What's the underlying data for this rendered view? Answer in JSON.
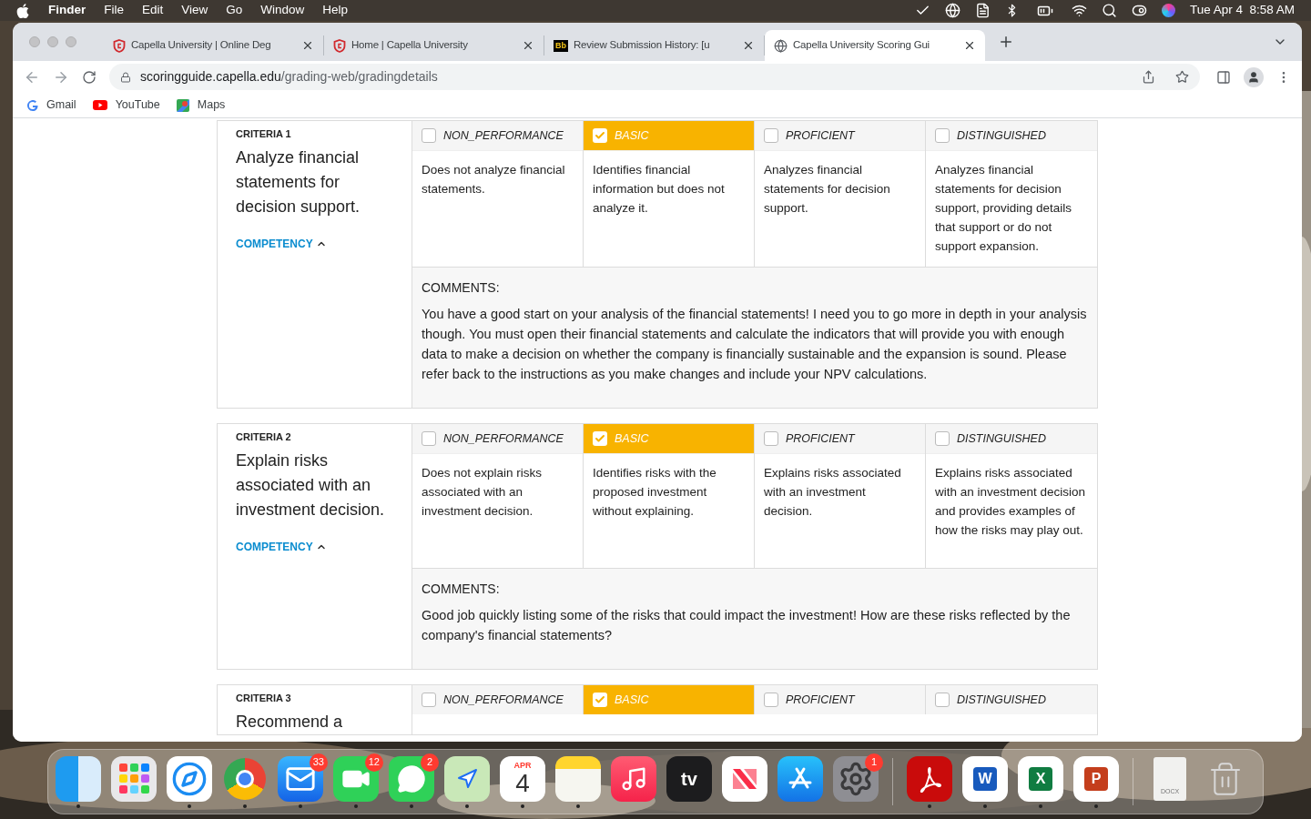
{
  "menu_bar": {
    "app": "Finder",
    "menus": [
      "File",
      "Edit",
      "View",
      "Go",
      "Window",
      "Help"
    ],
    "clock": "Tue Apr 4  8:58 AM"
  },
  "browser": {
    "tabs": [
      {
        "title": "Capella University | Online Deg",
        "selected": false,
        "kind": "shield"
      },
      {
        "title": "Home | Capella University",
        "selected": false,
        "kind": "shield"
      },
      {
        "title": "Review Submission History: [u",
        "selected": false,
        "kind": "bb",
        "icon_label": "Bb"
      },
      {
        "title": "Capella University Scoring Gui",
        "selected": true,
        "kind": "globe"
      }
    ],
    "address_host": "scoringguide.capella.edu",
    "address_path": "/grading-web/gradingdetails",
    "bookmarks": [
      {
        "label": "Gmail",
        "kind": "gmail"
      },
      {
        "label": "YouTube",
        "kind": "youtube"
      },
      {
        "label": "Maps",
        "kind": "maps"
      }
    ]
  },
  "criteria": [
    {
      "label": "CRITERIA 1",
      "title": "Analyze financial statements for decision support.",
      "competency": "COMPETENCY",
      "levels": [
        {
          "label": "NON_PERFORMANCE",
          "selected": false,
          "description": "Does not analyze financial statements."
        },
        {
          "label": "BASIC",
          "selected": true,
          "description": "Identifies financial information but does not analyze it."
        },
        {
          "label": "PROFICIENT",
          "selected": false,
          "description": "Analyzes financial statements for decision support."
        },
        {
          "label": "DISTINGUISHED",
          "selected": false,
          "description": "Analyzes financial statements for decision support, providing details that support or do not support expansion."
        }
      ],
      "comments_label": "COMMENTS:",
      "comment": "You have a good start on your analysis of the financial statements! I need you to go more in depth in your analysis though. You must open their financial statements and calculate the indicators that will provide you with enough data to make a decision on whether the company is financially sustainable and the expansion is sound. Please refer back to the instructions as you make changes and include your NPV calculations."
    },
    {
      "label": "CRITERIA 2",
      "title": "Explain risks associated with an investment decision.",
      "competency": "COMPETENCY",
      "levels": [
        {
          "label": "NON_PERFORMANCE",
          "selected": false,
          "description": "Does not explain risks associated with an investment decision."
        },
        {
          "label": "BASIC",
          "selected": true,
          "description": "Identifies risks with the proposed investment without explaining."
        },
        {
          "label": "PROFICIENT",
          "selected": false,
          "description": "Explains risks associated with an investment decision."
        },
        {
          "label": "DISTINGUISHED",
          "selected": false,
          "description": "Explains risks associated with an investment decision and provides examples of how the risks may play out."
        }
      ],
      "comments_label": "COMMENTS:",
      "comment": "Good job quickly listing some of the risks that could impact the investment! How are these risks reflected by the company's financial statements?"
    },
    {
      "label": "CRITERIA 3",
      "title": "Recommend a",
      "levels": [
        {
          "label": "NON_PERFORMANCE",
          "selected": false
        },
        {
          "label": "BASIC",
          "selected": true
        },
        {
          "label": "PROFICIENT",
          "selected": false
        },
        {
          "label": "DISTINGUISHED",
          "selected": false
        }
      ]
    }
  ],
  "dock": [
    {
      "kind": "finder",
      "running": true
    },
    {
      "kind": "launchpad",
      "running": false
    },
    {
      "kind": "safari",
      "running": true
    },
    {
      "kind": "chrome",
      "running": true
    },
    {
      "kind": "mail",
      "running": true,
      "badge": "33"
    },
    {
      "kind": "facetime",
      "running": true,
      "badge": "12"
    },
    {
      "kind": "messages",
      "running": true,
      "badge": "2"
    },
    {
      "kind": "maps",
      "running": true
    },
    {
      "kind": "calendar",
      "running": true,
      "month": "APR",
      "day": "4"
    },
    {
      "kind": "notes",
      "running": true
    },
    {
      "kind": "music",
      "running": false
    },
    {
      "kind": "tv",
      "running": false,
      "label": "tv"
    },
    {
      "kind": "news",
      "running": false
    },
    {
      "kind": "appstore",
      "running": false
    },
    {
      "kind": "settings",
      "running": false,
      "badge": "1"
    },
    {
      "kind": "separator"
    },
    {
      "kind": "acrobat",
      "running": true
    },
    {
      "kind": "word",
      "running": true,
      "label": "W"
    },
    {
      "kind": "excel",
      "running": true,
      "label": "X"
    },
    {
      "kind": "powerpoint",
      "running": true,
      "label": "P"
    },
    {
      "kind": "separator"
    },
    {
      "kind": "file",
      "running": false,
      "label": "DOCX"
    },
    {
      "kind": "trash",
      "running": false
    }
  ]
}
